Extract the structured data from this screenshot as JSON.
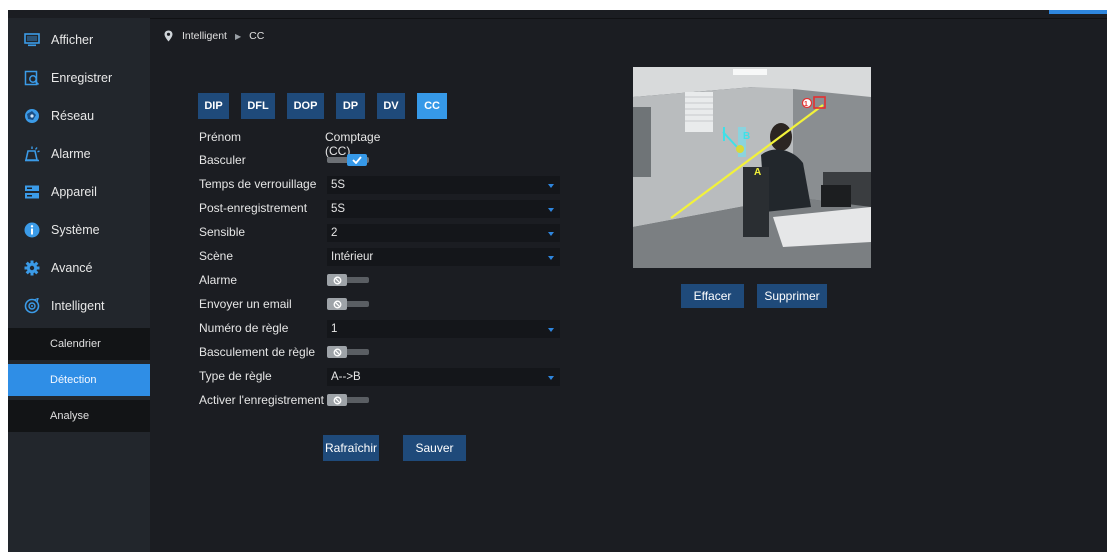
{
  "sidebar": {
    "items": [
      {
        "label": "Afficher",
        "icon": "monitor-icon"
      },
      {
        "label": "Enregistrer",
        "icon": "record-icon"
      },
      {
        "label": "Réseau",
        "icon": "network-icon"
      },
      {
        "label": "Alarme",
        "icon": "alarm-icon"
      },
      {
        "label": "Appareil",
        "icon": "device-icon"
      },
      {
        "label": "Système",
        "icon": "info-icon"
      },
      {
        "label": "Avancé",
        "icon": "gear-icon"
      },
      {
        "label": "Intelligent",
        "icon": "intelligent-icon"
      }
    ],
    "sub_items": [
      {
        "label": "Calendrier",
        "active": false
      },
      {
        "label": "Détection",
        "active": true
      },
      {
        "label": "Analyse",
        "active": false
      }
    ]
  },
  "breadcrumb": {
    "section": "Intelligent",
    "page": "CC"
  },
  "tabs": [
    "DIP",
    "DFL",
    "DOP",
    "DP",
    "DV",
    "CC"
  ],
  "active_tab": "CC",
  "form": {
    "name_label": "Prénom",
    "name_value": "Comptage (CC)",
    "switch_label": "Basculer",
    "switch_on": true,
    "lock_time_label": "Temps de verrouillage",
    "lock_time_value": "5S",
    "post_record_label": "Post-enregistrement",
    "post_record_value": "5S",
    "sensitivity_label": "Sensible",
    "sensitivity_value": "2",
    "scene_label": "Scène",
    "scene_value": "Intérieur",
    "alarm_label": "Alarme",
    "alarm_on": false,
    "email_label": "Envoyer un email",
    "email_on": false,
    "rule_number_label": "Numéro de règle",
    "rule_number_value": "1",
    "rule_switch_label": "Basculement de règle",
    "rule_switch_on": false,
    "rule_type_label": "Type de règle",
    "rule_type_value": "A-->B",
    "record_label": "Activer l'enregistrement",
    "record_on": false
  },
  "buttons": {
    "refresh": "Rafraîchir",
    "save": "Sauver",
    "clear": "Effacer",
    "delete": "Supprimer"
  },
  "preview": {
    "line_label_a": "A",
    "line_label_b": "B",
    "rule_marker": "1"
  },
  "colors": {
    "accent": "#3699e8",
    "tab": "#1f4a7a",
    "sidebar": "#22262c",
    "background": "#1b1d22",
    "rule_line": "#f2f23a"
  }
}
